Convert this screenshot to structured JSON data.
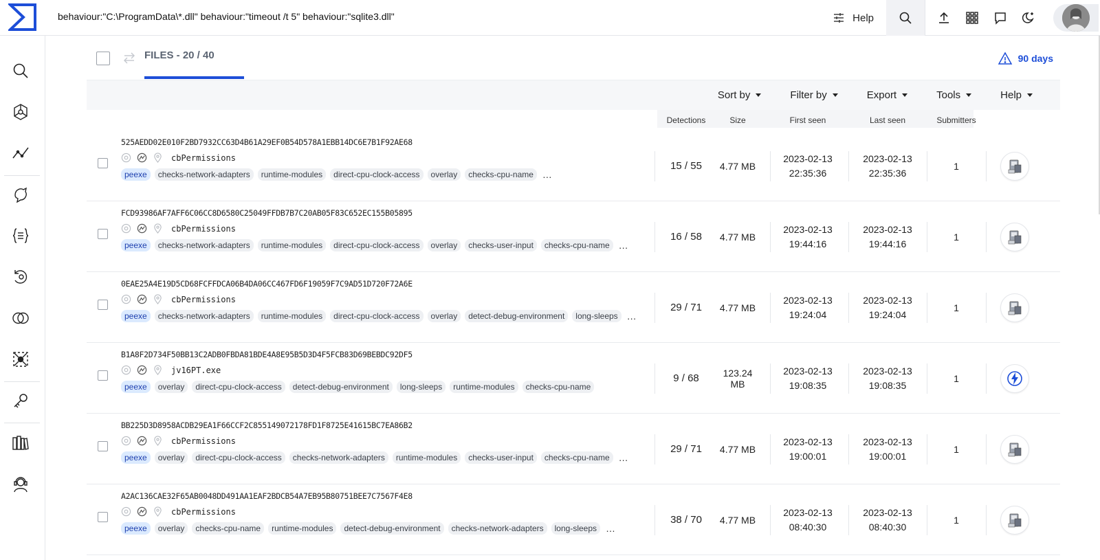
{
  "topbar": {
    "query": "behaviour:\"C:\\ProgramData\\*.dll\" behaviour:\"timeout /t 5\" behaviour:\"sqlite3.dll\"",
    "help_label": "Help",
    "icons": [
      "filter-settings-icon",
      "search-icon",
      "upload-icon",
      "apps-grid-icon",
      "chat-icon",
      "dark-mode-icon"
    ]
  },
  "sidebar": {
    "items": [
      "search-icon",
      "graph-hub-icon",
      "trends-icon",
      "hunting-icon",
      "yara-rules-icon",
      "retrohunt-icon",
      "diff-icon",
      "collections-icon",
      "api-key-icon",
      "library-icon",
      "support-icon"
    ]
  },
  "files_tab": {
    "label": "FILES - 20 / 40"
  },
  "ninety_days": {
    "label": "90 days",
    "color": "#1d4ed8"
  },
  "toolbar": [
    "Sort by",
    "Filter by",
    "Export",
    "Tools",
    "Help"
  ],
  "columns": {
    "detections": "Detections",
    "size": "Size",
    "first_seen": "First seen",
    "last_seen": "Last seen",
    "submitters": "Submitters"
  },
  "rows": [
    {
      "hash": "525AEDD02E010F2BD7932CC63D4B61A29EF0B54D578A1EBB14DC6E7B1F92AE68",
      "name": "cbPermissions",
      "tags": [
        "peexe",
        "checks-network-adapters",
        "runtime-modules",
        "direct-cpu-clock-access",
        "overlay",
        "checks-cpu-name"
      ],
      "more": "…",
      "detections": "15 / 55",
      "size": "4.77 MB",
      "first_date": "2023-02-13",
      "first_time": "22:35:36",
      "last_date": "2023-02-13",
      "last_time": "22:35:36",
      "submitters": "1",
      "icon": "installer-icon"
    },
    {
      "hash": "FCD93986AF7AFF6C06CC8D6580C25049FFDB7B7C20AB05F83C652EC155B05895",
      "name": "cbPermissions",
      "tags": [
        "peexe",
        "checks-network-adapters",
        "runtime-modules",
        "direct-cpu-clock-access",
        "overlay",
        "checks-user-input",
        "checks-cpu-name"
      ],
      "more": "…",
      "detections": "16 / 58",
      "size": "4.77 MB",
      "first_date": "2023-02-13",
      "first_time": "19:44:16",
      "last_date": "2023-02-13",
      "last_time": "19:44:16",
      "submitters": "1",
      "icon": "installer-icon"
    },
    {
      "hash": "0EAE25A4E19D5CD68FCFFDCA06B4DA06CC467FD6F19059F7C9AD51D720F72A6E",
      "name": "cbPermissions",
      "tags": [
        "peexe",
        "checks-network-adapters",
        "runtime-modules",
        "direct-cpu-clock-access",
        "overlay",
        "detect-debug-environment",
        "long-sleeps"
      ],
      "more": "…",
      "detections": "29 / 71",
      "size": "4.77 MB",
      "first_date": "2023-02-13",
      "first_time": "19:24:04",
      "last_date": "2023-02-13",
      "last_time": "19:24:04",
      "submitters": "1",
      "icon": "installer-icon"
    },
    {
      "hash": "B1A8F2D734F50BB13C2ADB0FBDA81BDE4A8E95B5D3D4F5FCB83D69BEBDC92DF5",
      "name": "jv16PT.exe",
      "tags": [
        "peexe",
        "overlay",
        "direct-cpu-clock-access",
        "detect-debug-environment",
        "long-sleeps",
        "runtime-modules",
        "checks-cpu-name"
      ],
      "more": "",
      "detections": "9 / 68",
      "size": "123.24 MB",
      "first_date": "2023-02-13",
      "first_time": "19:08:35",
      "last_date": "2023-02-13",
      "last_time": "19:08:35",
      "submitters": "1",
      "icon": "lightning-icon"
    },
    {
      "hash": "BB225D3D8958ACDB29EA1F66CCF2C855149072178FD1F8725E41615BC7EA86B2",
      "name": "cbPermissions",
      "tags": [
        "peexe",
        "overlay",
        "direct-cpu-clock-access",
        "checks-network-adapters",
        "runtime-modules",
        "checks-user-input",
        "checks-cpu-name"
      ],
      "more": "…",
      "detections": "29 / 71",
      "size": "4.77 MB",
      "first_date": "2023-02-13",
      "first_time": "19:00:01",
      "last_date": "2023-02-13",
      "last_time": "19:00:01",
      "submitters": "1",
      "icon": "installer-icon"
    },
    {
      "hash": "A2AC136CAE32F65AB0048DD491AA1EAF2BDCB54A7EB95B80751BEE7C7567F4E8",
      "name": "cbPermissions",
      "tags": [
        "peexe",
        "overlay",
        "checks-cpu-name",
        "runtime-modules",
        "detect-debug-environment",
        "checks-network-adapters",
        "long-sleeps"
      ],
      "more": "…",
      "detections": "38 / 70",
      "size": "4.77 MB",
      "first_date": "2023-02-13",
      "first_time": "08:40:30",
      "last_date": "2023-02-13",
      "last_time": "08:40:30",
      "submitters": "1",
      "icon": "installer-icon"
    }
  ]
}
